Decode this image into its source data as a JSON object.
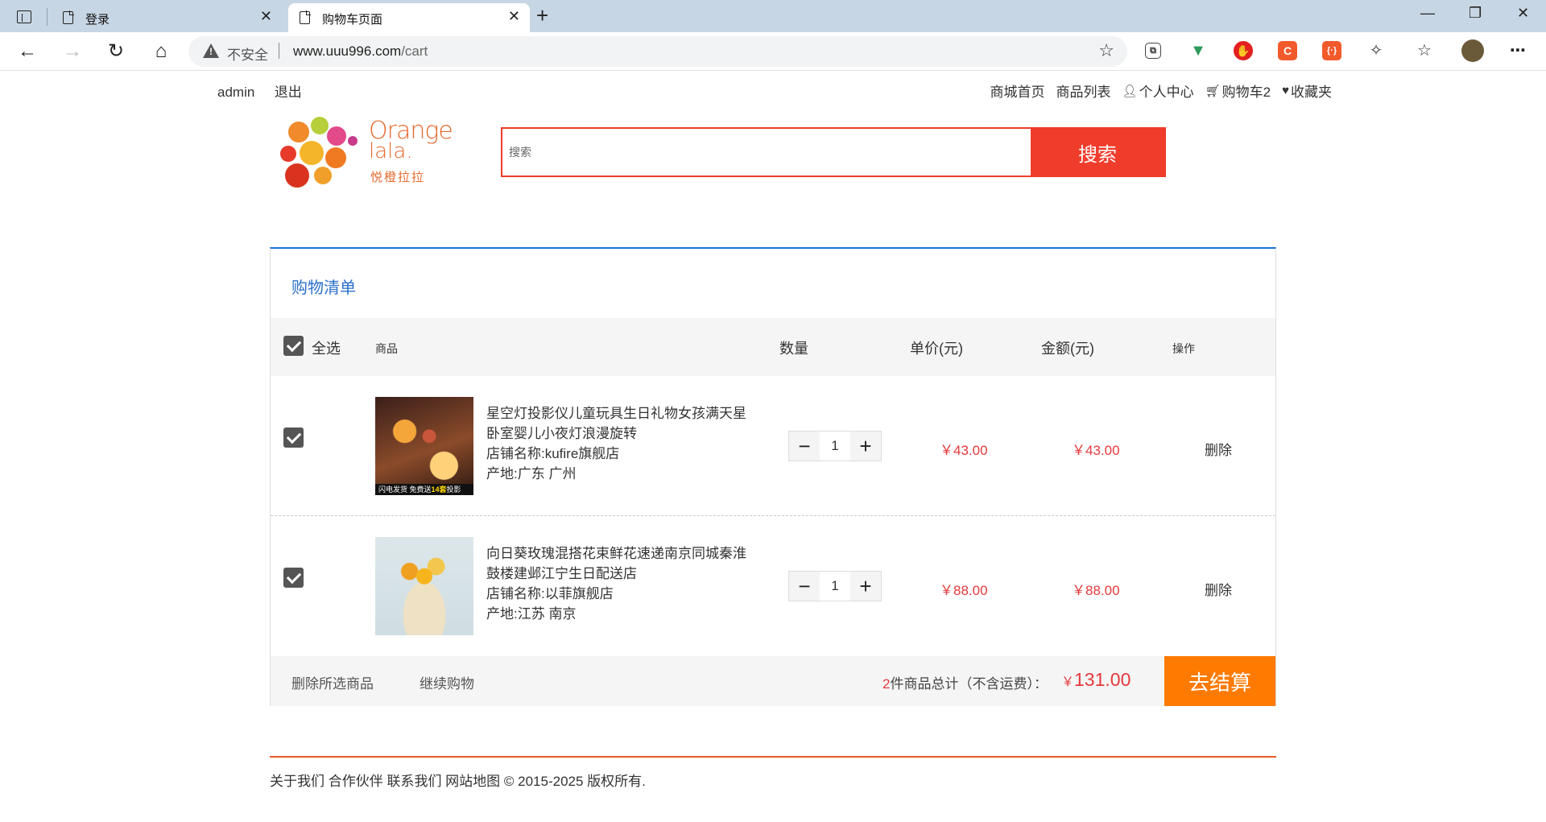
{
  "browser": {
    "tabs": [
      {
        "title": "登录",
        "active": false
      },
      {
        "title": "购物车页面",
        "active": true
      }
    ],
    "address": {
      "insecure_label": "不安全",
      "host": "www.uuu996.com",
      "path": "/cart"
    }
  },
  "header": {
    "user": "admin",
    "logout": "退出",
    "nav": {
      "home": "商城首页",
      "products": "商品列表",
      "profile": "个人中心",
      "cart": "购物车2",
      "favorites": "收藏夹"
    }
  },
  "logo": {
    "line1": "Orange",
    "line2": "lala.",
    "tagline": "悦橙拉拉"
  },
  "search": {
    "placeholder": "搜索",
    "button": "搜索"
  },
  "cart": {
    "title": "购物清单",
    "headers": {
      "select_all": "全选",
      "product": "商品",
      "quantity": "数量",
      "unit_price": "单价(元)",
      "amount": "金额(元)",
      "actions": "操作"
    },
    "items": [
      {
        "checked": true,
        "name": "星空灯投影仪儿童玩具生日礼物女孩满天星卧室婴儿小夜灯浪漫旋转",
        "shop": "店铺名称:kufire旗舰店",
        "origin": "产地:广东 广州",
        "image_badge_left": "闪电发货 免费送",
        "image_badge_hl": "14套",
        "image_badge_right": "投影",
        "quantity": "1",
        "unit_price": "￥43.00",
        "amount": "￥43.00",
        "delete": "删除"
      },
      {
        "checked": true,
        "name": "向日葵玫瑰混搭花束鲜花速递南京同城秦淮鼓楼建邺江宁生日配送店",
        "shop": "店铺名称:以菲旗舰店",
        "origin": "产地:江苏 南京",
        "quantity": "1",
        "unit_price": "￥88.00",
        "amount": "￥88.00",
        "delete": "删除"
      }
    ],
    "footer": {
      "delete_selected": "删除所选商品",
      "continue": "继续购物",
      "count": "2",
      "total_label": "件商品总计（不含运费）：",
      "total_currency": "￥",
      "total_value": "131.00",
      "checkout": "去结算"
    }
  },
  "site_footer": "关于我们 合作伙伴 联系我们 网站地图 © 2015-2025 版权所有.",
  "colors": {
    "accent_red": "#f03c2b",
    "price_red": "#e4393c",
    "checkout_orange": "#ff7a00",
    "title_blue": "#2a6fca"
  }
}
